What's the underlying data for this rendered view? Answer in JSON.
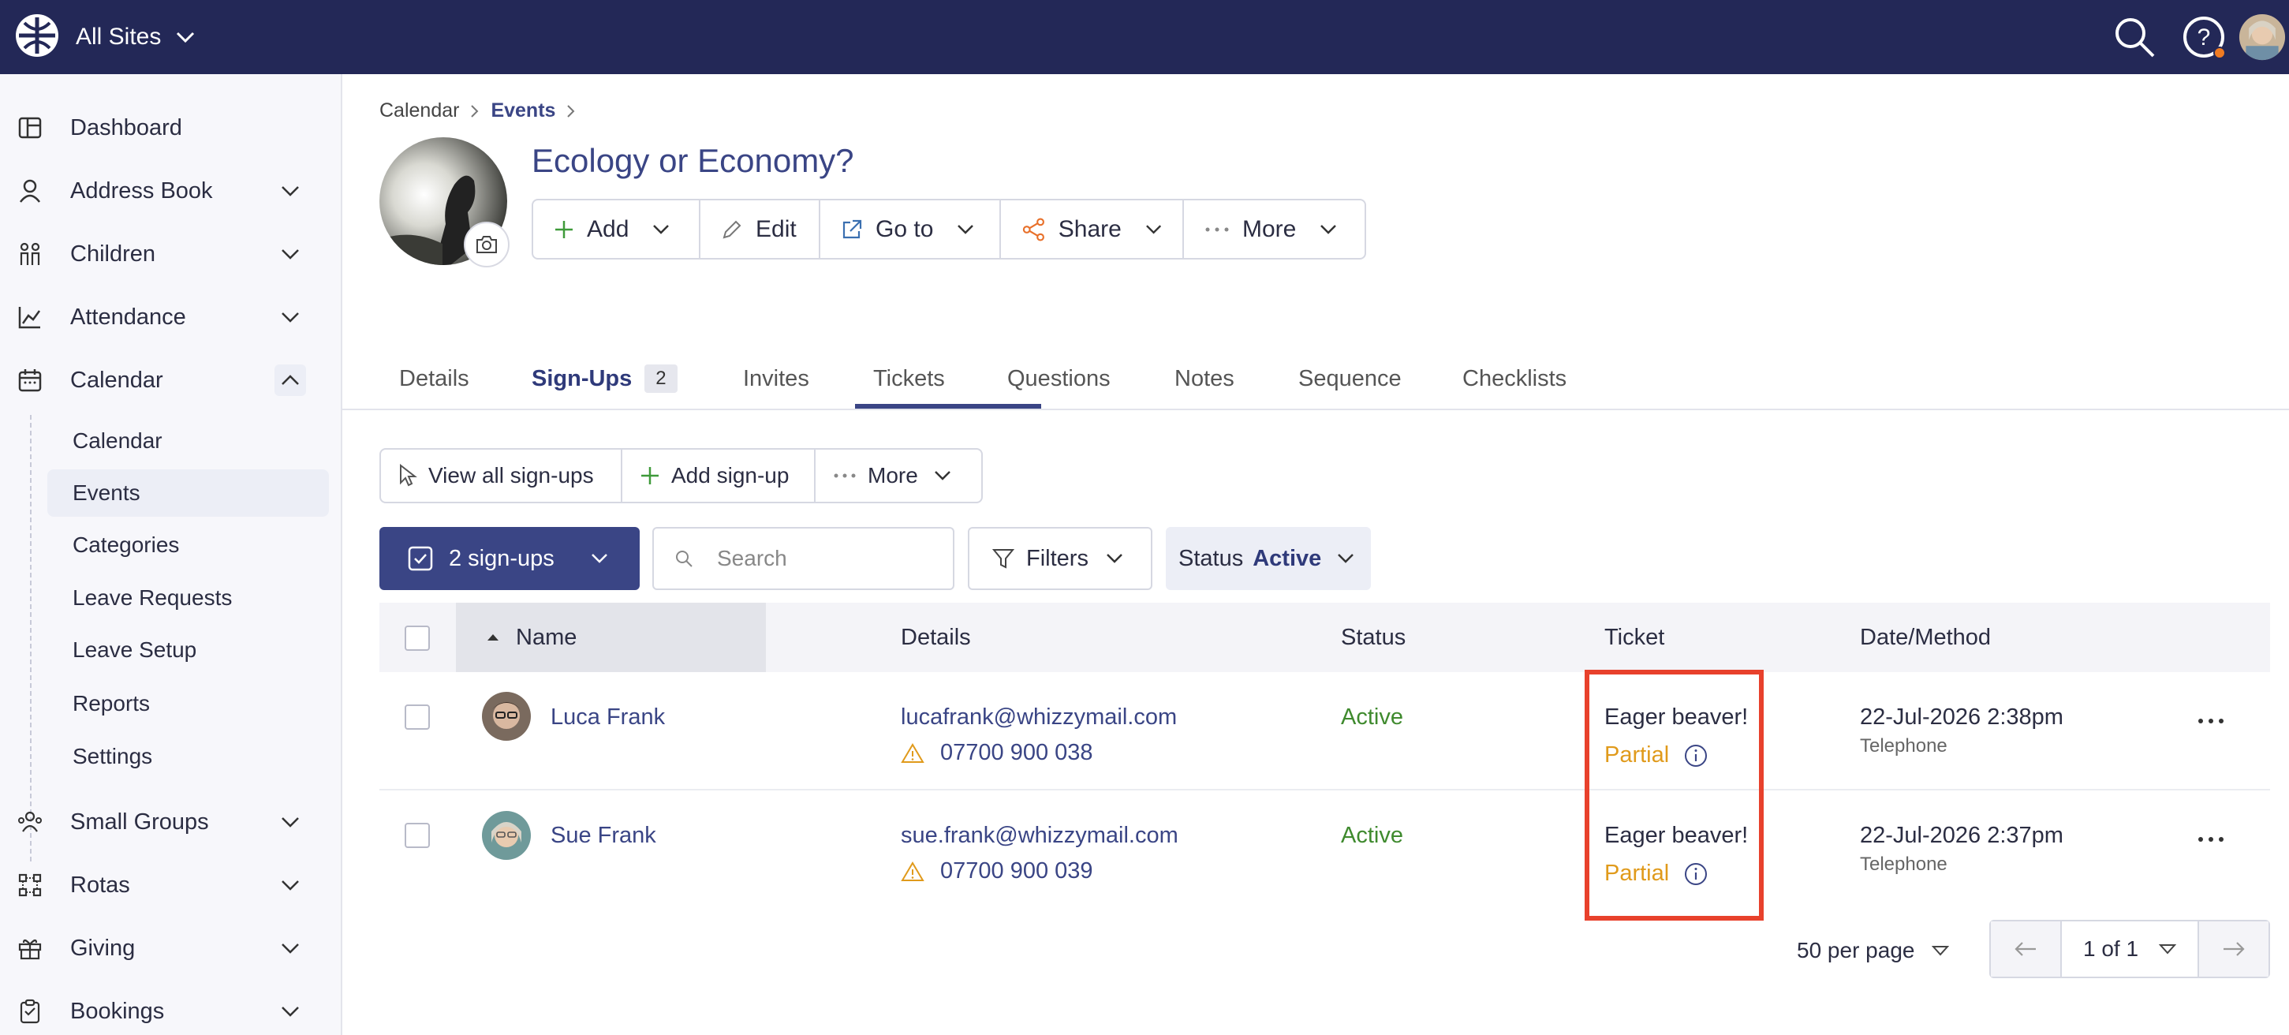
{
  "topbar": {
    "site_label": "All Sites",
    "icons": [
      "logo-icon",
      "search-icon",
      "help-icon",
      "user-avatar"
    ]
  },
  "sidebar": {
    "items": [
      {
        "label": "Dashboard",
        "icon": "dashboard-icon"
      },
      {
        "label": "Address Book",
        "icon": "person-icon"
      },
      {
        "label": "Children",
        "icon": "children-icon"
      },
      {
        "label": "Attendance",
        "icon": "chart-icon"
      },
      {
        "label": "Calendar",
        "icon": "calendar-icon"
      },
      {
        "label": "Small Groups",
        "icon": "group-icon"
      },
      {
        "label": "Rotas",
        "icon": "rota-icon"
      },
      {
        "label": "Giving",
        "icon": "gift-icon"
      },
      {
        "label": "Bookings",
        "icon": "clipboard-icon"
      }
    ],
    "calendar_sub": [
      "Calendar",
      "Events",
      "Categories",
      "Leave Requests",
      "Leave Setup",
      "Reports",
      "Settings"
    ],
    "active_sub": "Events"
  },
  "breadcrumb": {
    "parent": "Calendar",
    "current": "Events"
  },
  "page": {
    "title": "Ecology or Economy?"
  },
  "actions": {
    "add": "Add",
    "edit": "Edit",
    "goto": "Go to",
    "share": "Share",
    "more": "More"
  },
  "tabs": {
    "items": [
      "Details",
      "Sign-Ups",
      "Invites",
      "Tickets",
      "Questions",
      "Notes",
      "Sequence",
      "Checklists"
    ],
    "active": "Sign-Ups",
    "signups_count": "2"
  },
  "signup_toolbar": {
    "view_all": "View all sign-ups",
    "add": "Add sign-up",
    "more": "More"
  },
  "filters": {
    "selection": "2 sign-ups",
    "search_placeholder": "Search",
    "filters_label": "Filters",
    "status_label": "Status",
    "status_value": "Active"
  },
  "table": {
    "columns": [
      "Name",
      "Details",
      "Status",
      "Ticket",
      "Date/Method"
    ],
    "rows": [
      {
        "name": "Luca Frank",
        "email": "lucafrank@whizzymail.com",
        "phone": "07700 900 038",
        "status": "Active",
        "ticket": "Eager beaver!",
        "ticket_status": "Partial",
        "date": "22-Jul-2026 2:38pm",
        "method": "Telephone"
      },
      {
        "name": "Sue Frank",
        "email": "sue.frank@whizzymail.com",
        "phone": "07700 900 039",
        "status": "Active",
        "ticket": "Eager beaver!",
        "ticket_status": "Partial",
        "date": "22-Jul-2026 2:37pm",
        "method": "Telephone"
      }
    ]
  },
  "pagination": {
    "per_page": "50 per page",
    "page": "1 of 1"
  },
  "colors": {
    "topbar": "#232857",
    "accent": "#3a4585",
    "active_status": "#3f8a2e",
    "partial": "#e09a1b",
    "highlight": "#e8412c"
  }
}
